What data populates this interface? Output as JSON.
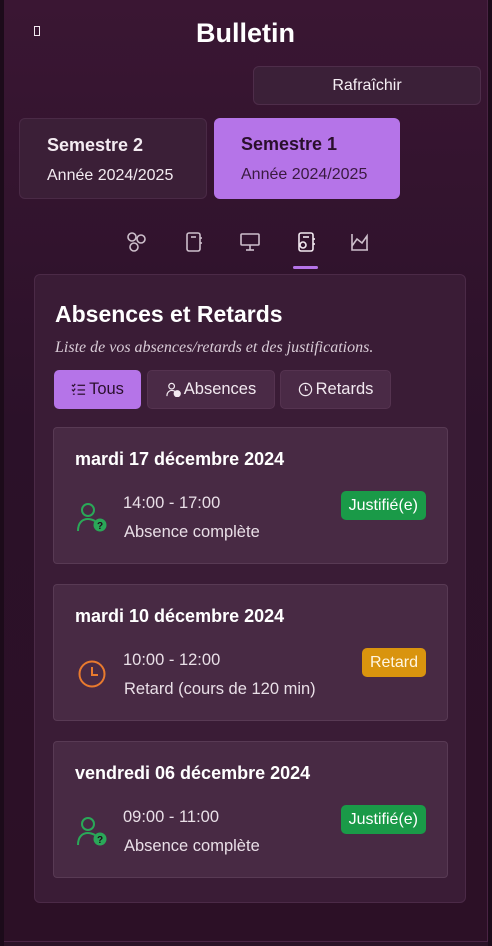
{
  "header": {
    "title": "Bulletin",
    "refresh_label": "Rafraîchir"
  },
  "semesters": [
    {
      "name": "Semestre 2",
      "year": "Année 2024/2025",
      "selected": false
    },
    {
      "name": "Semestre 1",
      "year": "Année 2024/2025",
      "selected": true
    }
  ],
  "tabs": [
    {
      "icon": "grades-icon",
      "selected": false
    },
    {
      "icon": "notebook-icon",
      "selected": false
    },
    {
      "icon": "presentation-icon",
      "selected": false
    },
    {
      "icon": "absences-icon",
      "selected": true
    },
    {
      "icon": "chart-icon",
      "selected": false
    }
  ],
  "absences": {
    "title": "Absences et Retards",
    "subtitle": "Liste de vos absences/retards et des justifications.",
    "filters": {
      "all": "Tous",
      "absences": "Absences",
      "delays": "Retards"
    },
    "entries": [
      {
        "date": "mardi 17 décembre 2024",
        "time": "14:00 - 17:00",
        "description": "Absence complète",
        "badge": "Justifié(e)",
        "kind": "absence"
      },
      {
        "date": "mardi 10 décembre 2024",
        "time": "10:00 - 12:00",
        "description": "Retard (cours de 120 min)",
        "badge": "Retard",
        "kind": "retard"
      },
      {
        "date": "vendredi 06 décembre 2024",
        "time": "09:00 - 11:00",
        "description": "Absence complète",
        "badge": "Justifié(e)",
        "kind": "absence"
      }
    ]
  },
  "colors": {
    "accent": "#b574e8",
    "justified": "#1a9a48",
    "delay": "#d9940e",
    "absence_icon": "#2aa858",
    "delay_icon": "#e87a2e"
  }
}
